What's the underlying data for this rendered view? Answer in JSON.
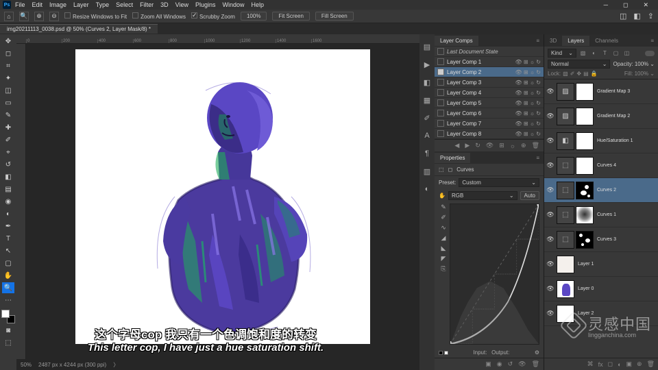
{
  "app": {
    "logo": "Ps"
  },
  "menu": [
    "File",
    "Edit",
    "Image",
    "Layer",
    "Type",
    "Select",
    "Filter",
    "3D",
    "View",
    "Plugins",
    "Window",
    "Help"
  ],
  "options": {
    "resize": "Resize Windows to Fit",
    "zoomall": "Zoom All Windows",
    "scrubby": "Scrubby Zoom",
    "pct": "100%",
    "fit": "Fit Screen",
    "fill": "Fill Screen"
  },
  "doc": {
    "title": "img20211113_0038.psd @ 50% (Curves 2, Layer Mask/8) *"
  },
  "ruler": [
    "0",
    "200",
    "400",
    "600",
    "800",
    "1000",
    "1200",
    "1400",
    "1600"
  ],
  "status": {
    "zoom": "50%",
    "dims": "2487 px x 4244 px (300 ppi)"
  },
  "panel_labels": {
    "layer_comps": "Layer Comps",
    "properties": "Properties",
    "layers": "Layers",
    "channels": "Channels",
    "3d": "3D"
  },
  "layer_comps": {
    "last": "Last Document State",
    "items": [
      "Layer Comp 1",
      "Layer Comp 2",
      "Layer Comp 3",
      "Layer Comp 4",
      "Layer Comp 5",
      "Layer Comp 6",
      "Layer Comp 7",
      "Layer Comp 8"
    ],
    "selected": 1
  },
  "properties": {
    "type": "Curves",
    "preset_label": "Preset:",
    "preset": "Custom",
    "channel": "RGB",
    "auto": "Auto",
    "input_label": "Input:",
    "output_label": "Output:"
  },
  "layers_panel": {
    "kind": "Kind",
    "mode": "Normal",
    "opacity_label": "Opacity:",
    "opacity": "100%",
    "lock_label": "Lock:",
    "fill_label": "Fill:",
    "fill": "100%",
    "items": [
      {
        "name": "Gradient Map 3",
        "adj": "▨",
        "mask": "white"
      },
      {
        "name": "Gradient Map 2",
        "adj": "▨",
        "mask": "white"
      },
      {
        "name": "Hue/Saturation 1",
        "adj": "◧",
        "mask": "white"
      },
      {
        "name": "Curves 4",
        "adj": "⬚",
        "mask": "white"
      },
      {
        "name": "Curves 2",
        "adj": "⬚",
        "mask": "speck1",
        "sel": true
      },
      {
        "name": "Curves 1",
        "adj": "⬚",
        "mask": "blur"
      },
      {
        "name": "Curves 3",
        "adj": "⬚",
        "mask": "speck2"
      },
      {
        "name": "Layer 1",
        "img": "paper",
        "mask": ""
      },
      {
        "name": "Layer 0",
        "img": "figure",
        "mask": ""
      },
      {
        "name": "Layer 2",
        "img": "blank",
        "mask": ""
      }
    ]
  },
  "subs": {
    "cn": "这个字母cop 我只有一个色调饱和度的转变",
    "en": "This letter cop, I have just a hue saturation shift."
  },
  "watermark": {
    "cn": "灵感中国",
    "en": "lingganchina.com"
  }
}
